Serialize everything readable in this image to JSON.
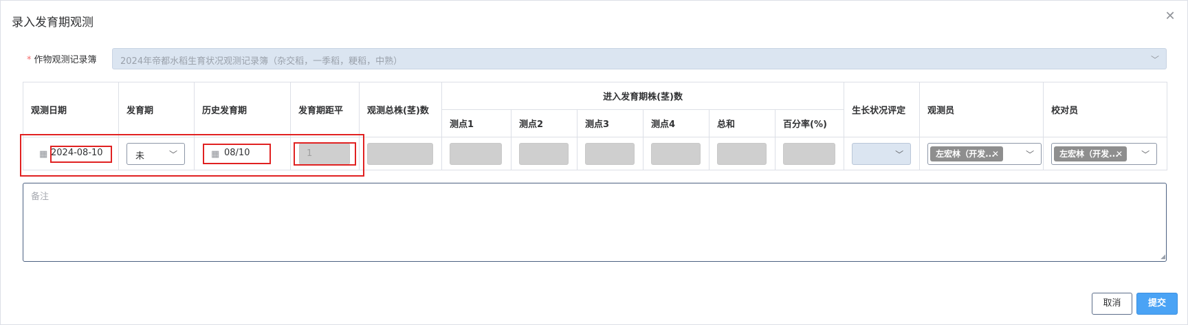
{
  "dialog": {
    "title": "录入发育期观测",
    "close_icon": "close-icon"
  },
  "form": {
    "required_mark": "*",
    "book_label": "作物观测记录簿",
    "book_value": "2024年帝都水稻生育状况观测记录簿（杂交稻，一季稻，粳稻，中熟）"
  },
  "table": {
    "headers": {
      "obs_date": "观测日期",
      "stage": "发育期",
      "hist_stage": "历史发育期",
      "stage_dist": "发育期距平",
      "total_plants": "观测总株(茎)数",
      "enter_group": "进入发育期株(茎)数",
      "p1": "测点1",
      "p2": "测点2",
      "p3": "测点3",
      "p4": "测点4",
      "sum": "总和",
      "percent": "百分率(%)",
      "growth_eval": "生长状况评定",
      "observer": "观测员",
      "checker": "校对员"
    },
    "row": {
      "obs_date": "2024-08-10",
      "stage": "未",
      "hist_stage": "08/10",
      "stage_dist": "1",
      "observer_tag": "左宏林（开发...",
      "checker_tag": "左宏林（开发..."
    }
  },
  "remark": {
    "placeholder": "备注"
  },
  "buttons": {
    "cancel": "取消",
    "submit": "提交"
  },
  "colors": {
    "accent": "#4aa3f5",
    "highlight": "#e02020",
    "disabled_fill": "#cfcfcf",
    "readonly_fill": "#dbe5f1"
  }
}
